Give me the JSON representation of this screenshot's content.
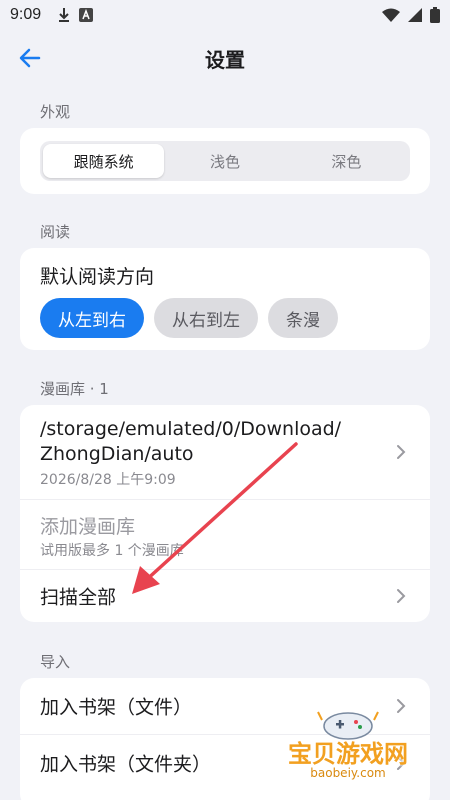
{
  "status_bar": {
    "time": "9:09",
    "icons": [
      "download-icon",
      "a-badge-icon",
      "wifi-icon",
      "signal-icon",
      "battery-icon"
    ]
  },
  "app_bar": {
    "title": "设置",
    "back_icon": "arrow-left-icon"
  },
  "appearance": {
    "label": "外观",
    "options": [
      "跟随系统",
      "浅色",
      "深色"
    ],
    "selected": "跟随系统"
  },
  "reading": {
    "label": "阅读",
    "title": "默认阅读方向",
    "options": [
      "从左到右",
      "从右到左",
      "条漫"
    ],
    "selected": "从左到右"
  },
  "library": {
    "label": "漫画库 · 1",
    "path_line1": "/storage/emulated/0/Download/",
    "path_line2": "ZhongDian/auto",
    "path_date": "2026/8/28 上午9:09",
    "add_title": "添加漫画库",
    "add_sub": "试用版最多 1 个漫画库",
    "scan_all": "扫描全部"
  },
  "import": {
    "label": "导入",
    "add_file": "加入书架（文件）",
    "add_folder": "加入书架（文件夹）"
  },
  "watermark": {
    "text": "宝贝游戏网",
    "url": "baobeiy.com"
  },
  "colors": {
    "accent": "#1a7cf0",
    "annotation_arrow": "#e8434f",
    "background": "#f1f2f7"
  }
}
